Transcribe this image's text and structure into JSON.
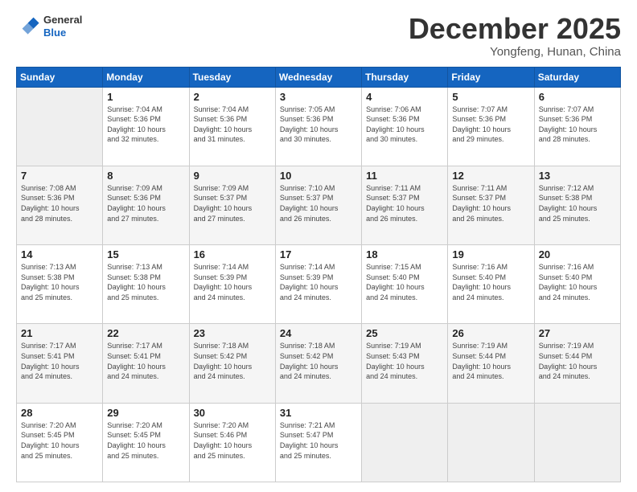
{
  "header": {
    "logo_general": "General",
    "logo_blue": "Blue",
    "month_title": "December 2025",
    "location": "Yongfeng, Hunan, China"
  },
  "days_of_week": [
    "Sunday",
    "Monday",
    "Tuesday",
    "Wednesday",
    "Thursday",
    "Friday",
    "Saturday"
  ],
  "weeks": [
    [
      {
        "day": "",
        "info": ""
      },
      {
        "day": "1",
        "info": "Sunrise: 7:04 AM\nSunset: 5:36 PM\nDaylight: 10 hours\nand 32 minutes."
      },
      {
        "day": "2",
        "info": "Sunrise: 7:04 AM\nSunset: 5:36 PM\nDaylight: 10 hours\nand 31 minutes."
      },
      {
        "day": "3",
        "info": "Sunrise: 7:05 AM\nSunset: 5:36 PM\nDaylight: 10 hours\nand 30 minutes."
      },
      {
        "day": "4",
        "info": "Sunrise: 7:06 AM\nSunset: 5:36 PM\nDaylight: 10 hours\nand 30 minutes."
      },
      {
        "day": "5",
        "info": "Sunrise: 7:07 AM\nSunset: 5:36 PM\nDaylight: 10 hours\nand 29 minutes."
      },
      {
        "day": "6",
        "info": "Sunrise: 7:07 AM\nSunset: 5:36 PM\nDaylight: 10 hours\nand 28 minutes."
      }
    ],
    [
      {
        "day": "7",
        "info": "Sunrise: 7:08 AM\nSunset: 5:36 PM\nDaylight: 10 hours\nand 28 minutes."
      },
      {
        "day": "8",
        "info": "Sunrise: 7:09 AM\nSunset: 5:36 PM\nDaylight: 10 hours\nand 27 minutes."
      },
      {
        "day": "9",
        "info": "Sunrise: 7:09 AM\nSunset: 5:37 PM\nDaylight: 10 hours\nand 27 minutes."
      },
      {
        "day": "10",
        "info": "Sunrise: 7:10 AM\nSunset: 5:37 PM\nDaylight: 10 hours\nand 26 minutes."
      },
      {
        "day": "11",
        "info": "Sunrise: 7:11 AM\nSunset: 5:37 PM\nDaylight: 10 hours\nand 26 minutes."
      },
      {
        "day": "12",
        "info": "Sunrise: 7:11 AM\nSunset: 5:37 PM\nDaylight: 10 hours\nand 26 minutes."
      },
      {
        "day": "13",
        "info": "Sunrise: 7:12 AM\nSunset: 5:38 PM\nDaylight: 10 hours\nand 25 minutes."
      }
    ],
    [
      {
        "day": "14",
        "info": "Sunrise: 7:13 AM\nSunset: 5:38 PM\nDaylight: 10 hours\nand 25 minutes."
      },
      {
        "day": "15",
        "info": "Sunrise: 7:13 AM\nSunset: 5:38 PM\nDaylight: 10 hours\nand 25 minutes."
      },
      {
        "day": "16",
        "info": "Sunrise: 7:14 AM\nSunset: 5:39 PM\nDaylight: 10 hours\nand 24 minutes."
      },
      {
        "day": "17",
        "info": "Sunrise: 7:14 AM\nSunset: 5:39 PM\nDaylight: 10 hours\nand 24 minutes."
      },
      {
        "day": "18",
        "info": "Sunrise: 7:15 AM\nSunset: 5:40 PM\nDaylight: 10 hours\nand 24 minutes."
      },
      {
        "day": "19",
        "info": "Sunrise: 7:16 AM\nSunset: 5:40 PM\nDaylight: 10 hours\nand 24 minutes."
      },
      {
        "day": "20",
        "info": "Sunrise: 7:16 AM\nSunset: 5:40 PM\nDaylight: 10 hours\nand 24 minutes."
      }
    ],
    [
      {
        "day": "21",
        "info": "Sunrise: 7:17 AM\nSunset: 5:41 PM\nDaylight: 10 hours\nand 24 minutes."
      },
      {
        "day": "22",
        "info": "Sunrise: 7:17 AM\nSunset: 5:41 PM\nDaylight: 10 hours\nand 24 minutes."
      },
      {
        "day": "23",
        "info": "Sunrise: 7:18 AM\nSunset: 5:42 PM\nDaylight: 10 hours\nand 24 minutes."
      },
      {
        "day": "24",
        "info": "Sunrise: 7:18 AM\nSunset: 5:42 PM\nDaylight: 10 hours\nand 24 minutes."
      },
      {
        "day": "25",
        "info": "Sunrise: 7:19 AM\nSunset: 5:43 PM\nDaylight: 10 hours\nand 24 minutes."
      },
      {
        "day": "26",
        "info": "Sunrise: 7:19 AM\nSunset: 5:44 PM\nDaylight: 10 hours\nand 24 minutes."
      },
      {
        "day": "27",
        "info": "Sunrise: 7:19 AM\nSunset: 5:44 PM\nDaylight: 10 hours\nand 24 minutes."
      }
    ],
    [
      {
        "day": "28",
        "info": "Sunrise: 7:20 AM\nSunset: 5:45 PM\nDaylight: 10 hours\nand 25 minutes."
      },
      {
        "day": "29",
        "info": "Sunrise: 7:20 AM\nSunset: 5:45 PM\nDaylight: 10 hours\nand 25 minutes."
      },
      {
        "day": "30",
        "info": "Sunrise: 7:20 AM\nSunset: 5:46 PM\nDaylight: 10 hours\nand 25 minutes."
      },
      {
        "day": "31",
        "info": "Sunrise: 7:21 AM\nSunset: 5:47 PM\nDaylight: 10 hours\nand 25 minutes."
      },
      {
        "day": "",
        "info": ""
      },
      {
        "day": "",
        "info": ""
      },
      {
        "day": "",
        "info": ""
      }
    ]
  ]
}
